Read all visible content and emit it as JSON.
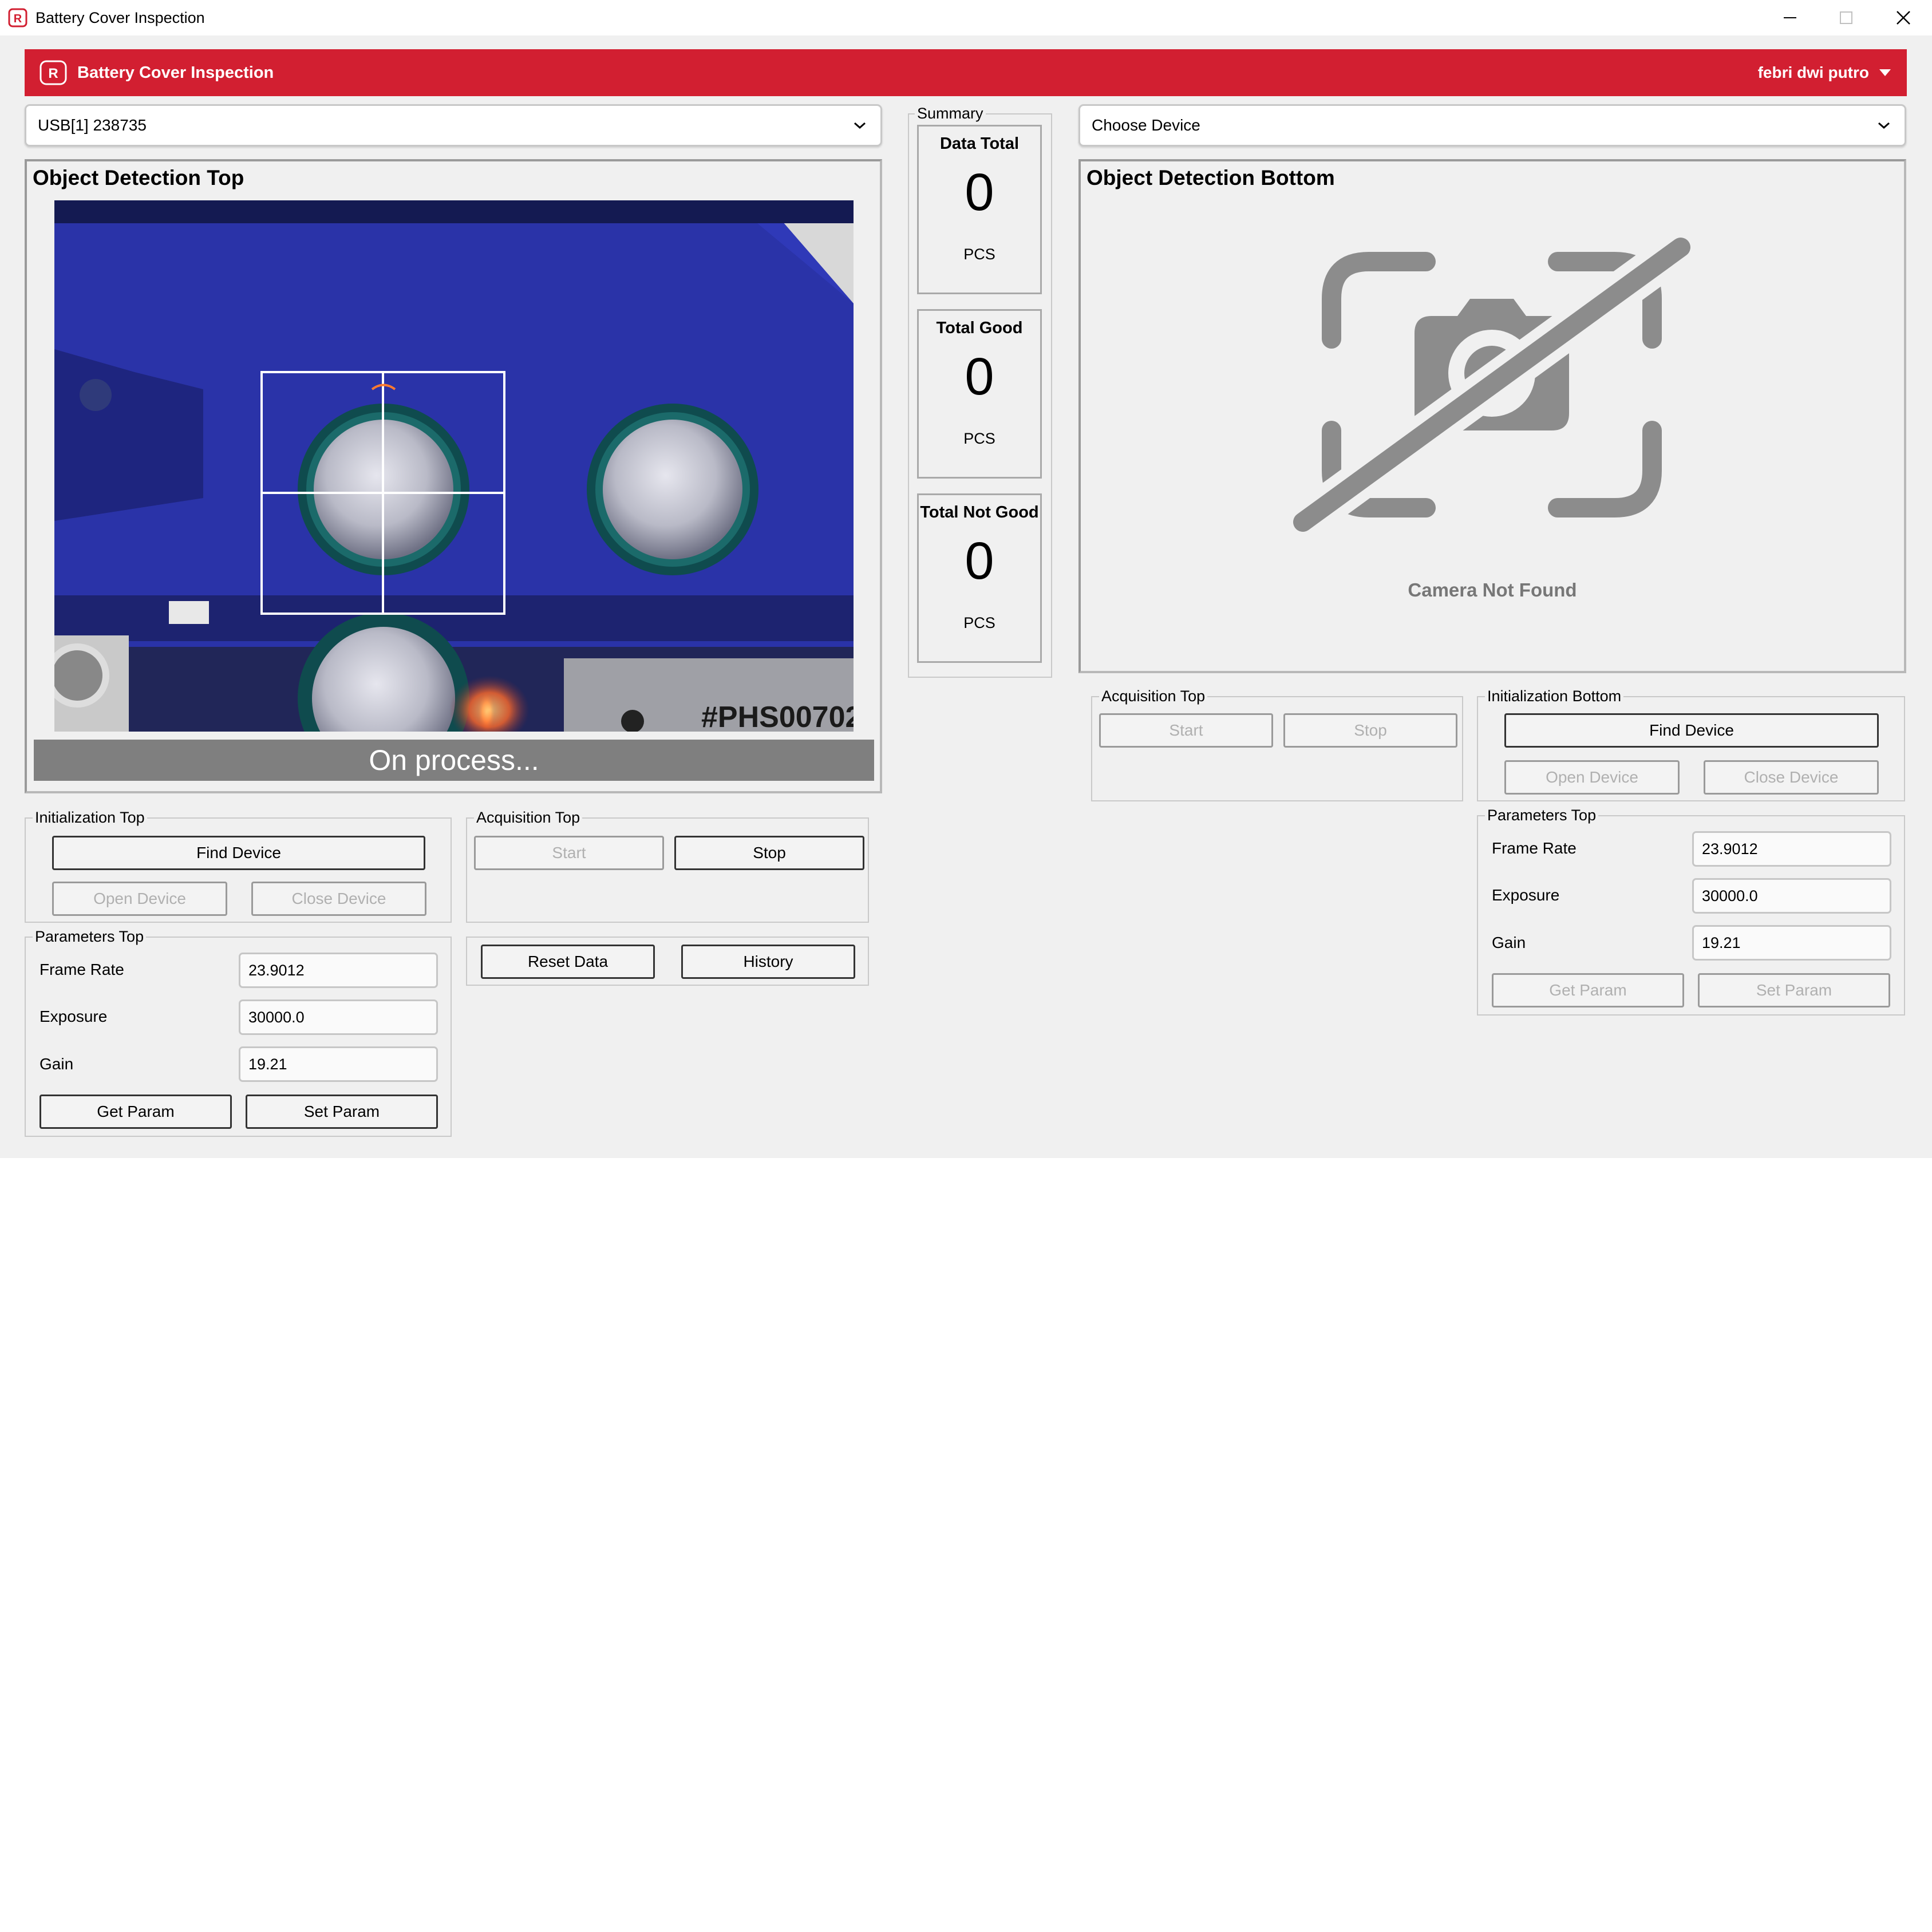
{
  "window": {
    "title": "Battery Cover Inspection"
  },
  "header": {
    "title": "Battery Cover Inspection",
    "user": "febri dwi putro"
  },
  "top_device_select": {
    "value": "USB[1] 238735"
  },
  "bottom_device_select": {
    "value": "Choose Device"
  },
  "top_detection": {
    "title": "Object Detection Top",
    "status": "On process...",
    "camera_label": "#PHS00702"
  },
  "bottom_detection": {
    "title": "Object Detection Bottom",
    "message": "Camera Not Found"
  },
  "summary": {
    "label": "Summary",
    "cards": [
      {
        "title": "Data Total",
        "value": "0",
        "unit": "PCS"
      },
      {
        "title": "Total Good",
        "value": "0",
        "unit": "PCS"
      },
      {
        "title": "Total Not Good",
        "value": "0",
        "unit": "PCS"
      }
    ]
  },
  "init_top": {
    "label": "Initialization Top",
    "find": "Find Device",
    "open": "Open Device",
    "close": "Close Device"
  },
  "acq_top": {
    "label": "Acquisition Top",
    "start": "Start",
    "stop": "Stop"
  },
  "data_actions": {
    "reset": "Reset Data",
    "history": "History"
  },
  "params_top": {
    "label": "Parameters Top",
    "frame_rate_label": "Frame Rate",
    "frame_rate": "23.9012",
    "exposure_label": "Exposure",
    "exposure": "30000.0",
    "gain_label": "Gain",
    "gain": "19.21",
    "get": "Get Param",
    "set": "Set Param"
  },
  "acq_bottom": {
    "label": "Acquisition Top",
    "start": "Start",
    "stop": "Stop"
  },
  "init_bottom": {
    "label": "Initialization Bottom",
    "find": "Find Device",
    "open": "Open Device",
    "close": "Close Device"
  },
  "params_bottom": {
    "label": "Parameters Top",
    "frame_rate_label": "Frame Rate",
    "frame_rate": "23.9012",
    "exposure_label": "Exposure",
    "exposure": "30000.0",
    "gain_label": "Gain",
    "gain": "19.21",
    "get": "Get Param",
    "set": "Set Param"
  },
  "colors": {
    "brand_red": "#d21f31",
    "window_bg": "#f0f0f0",
    "camera_blue": "#2a33a8",
    "icon_gray": "#8c8c8c"
  }
}
